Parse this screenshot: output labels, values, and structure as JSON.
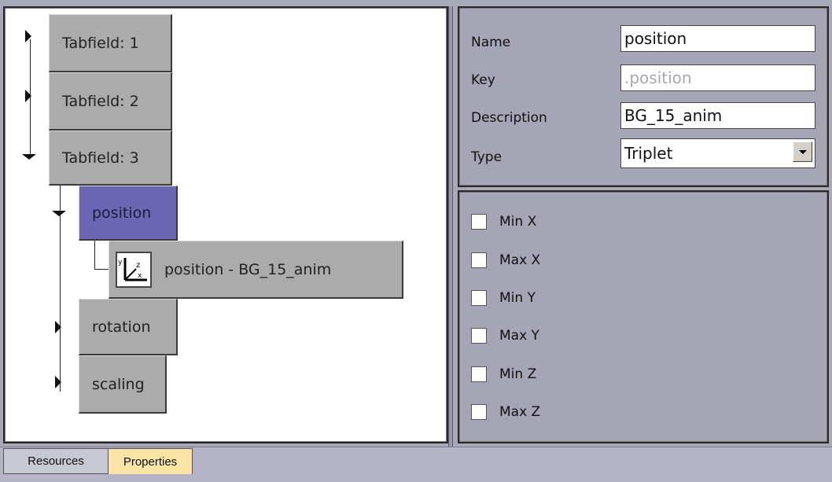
{
  "tree": {
    "tabfield1": "Tabfield: 1",
    "tabfield2": "Tabfield: 2",
    "tabfield3": "Tabfield: 3",
    "position": "position",
    "position_leaf": "position - BG_15_anim",
    "rotation": "rotation",
    "scaling": "scaling"
  },
  "properties": {
    "name_label": "Name",
    "name_value": "position",
    "key_label": "Key",
    "key_value": ".position",
    "description_label": "Description",
    "description_value": "BG_15_anim",
    "type_label": "Type",
    "type_value": "Triplet"
  },
  "checkboxes": [
    "Min X",
    "Max X",
    "Min Y",
    "Max Y",
    "Min Z",
    "Max Z"
  ],
  "tabs": {
    "resources": "Resources",
    "properties": "Properties"
  },
  "colors": {
    "selected_node": "#6b67b2",
    "active_tab": "#fbe4a7"
  },
  "icons": {
    "leaf": "xyz-axes-icon",
    "collapsed": "triangle-right-icon",
    "expanded": "triangle-down-icon"
  }
}
